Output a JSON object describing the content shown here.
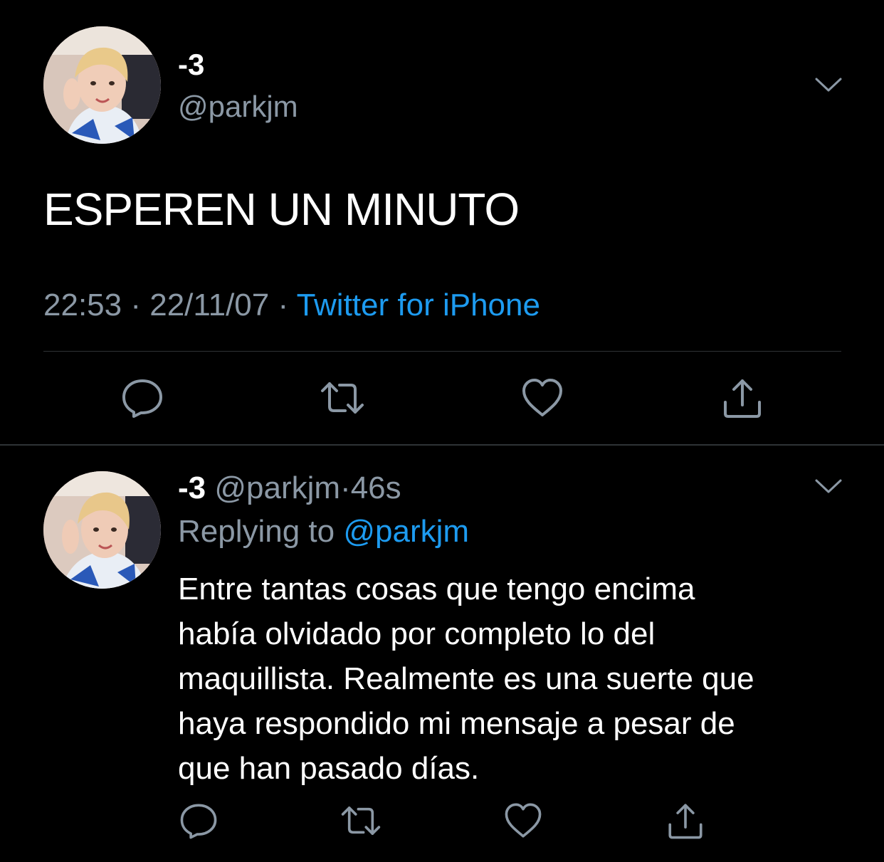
{
  "colors": {
    "background": "#000000",
    "text": "#ffffff",
    "secondary": "#8b98a5",
    "accent": "#1d9bf0",
    "divider": "#2f3336"
  },
  "main_tweet": {
    "display_name": "-3",
    "handle": "@parkjm",
    "avatar_icon": "profile-photo",
    "menu_icon": "chevron-down-icon",
    "text": "ESPEREN UN MINUTO",
    "time": "22:53",
    "separator": "·",
    "date": "22/11/07",
    "source": "Twitter for iPhone",
    "actions": [
      "reply-icon",
      "retweet-icon",
      "like-icon",
      "share-icon"
    ]
  },
  "reply_tweet": {
    "display_name": "-3",
    "handle": "@parkjm",
    "separator": "·",
    "time_ago": "46s",
    "replying_prefix": "Replying to",
    "replying_mention": "@parkjm",
    "text_lines": [
      "Entre tantas cosas que tengo encima",
      "había olvidado por completo lo del",
      "maquillista. Realmente es una suerte que",
      "haya respondido mi mensaje a pesar de",
      "que han pasado días."
    ],
    "menu_icon": "chevron-down-icon",
    "actions": [
      "reply-icon",
      "retweet-icon",
      "like-icon",
      "share-icon"
    ]
  }
}
